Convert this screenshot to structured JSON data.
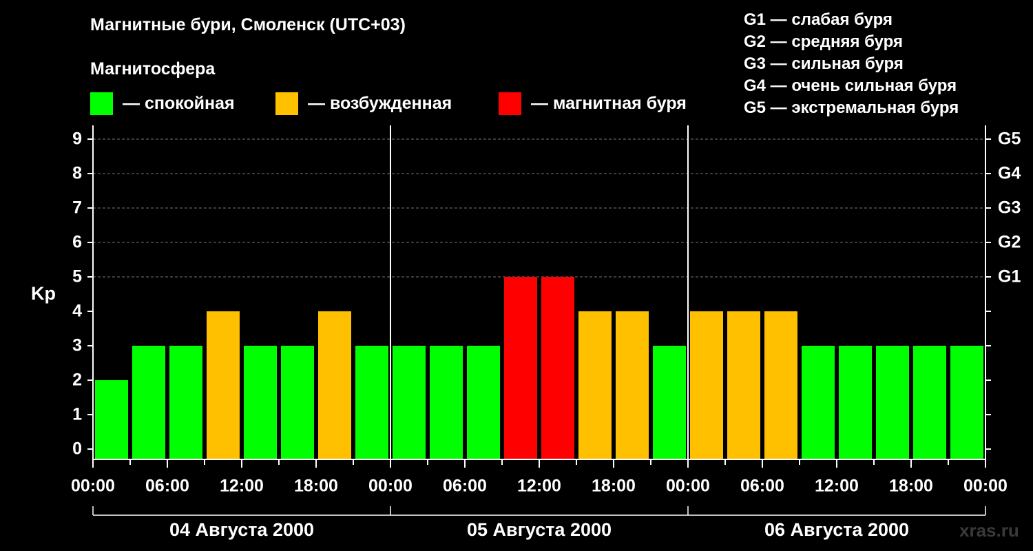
{
  "title": "Магнитные бури, Смоленск (UTC+03)",
  "subtitle": "Магнитосфера",
  "legend": [
    {
      "label": "— спокойная",
      "color": "#00ff00"
    },
    {
      "label": "— возбужденная",
      "color": "#ffc000"
    },
    {
      "label": "— магнитная буря",
      "color": "#ff0000"
    }
  ],
  "g_scale": [
    "G1 — слабая буря",
    "G2 — средняя буря",
    "G3 — сильная буря",
    "G4 — очень сильная буря",
    "G5 — экстремальная буря"
  ],
  "watermark": "xras.ru",
  "chart_data": {
    "type": "bar",
    "ylabel": "Kp",
    "ylim": [
      0,
      9
    ],
    "y_ticks": [
      "0",
      "1",
      "2",
      "3",
      "4",
      "5",
      "6",
      "7",
      "8",
      "9"
    ],
    "right_ticks": [
      {
        "kp": 5,
        "label": "G1"
      },
      {
        "kp": 6,
        "label": "G2"
      },
      {
        "kp": 7,
        "label": "G3"
      },
      {
        "kp": 8,
        "label": "G4"
      },
      {
        "kp": 9,
        "label": "G5"
      }
    ],
    "x_tick_labels": [
      "00:00",
      "06:00",
      "12:00",
      "18:00",
      "00:00",
      "06:00",
      "12:00",
      "18:00",
      "00:00",
      "06:00",
      "12:00",
      "18:00",
      "00:00"
    ],
    "days": [
      "04 Августа 2000",
      "05 Августа 2000",
      "06 Августа 2000"
    ],
    "values": [
      2,
      3,
      3,
      4,
      3,
      3,
      4,
      3,
      3,
      3,
      3,
      5,
      5,
      4,
      4,
      3,
      4,
      4,
      4,
      3,
      3,
      3,
      3,
      3
    ],
    "colors": {
      "quiet": "#00ff00",
      "active": "#ffc000",
      "storm": "#ff0000"
    },
    "grid": true
  }
}
